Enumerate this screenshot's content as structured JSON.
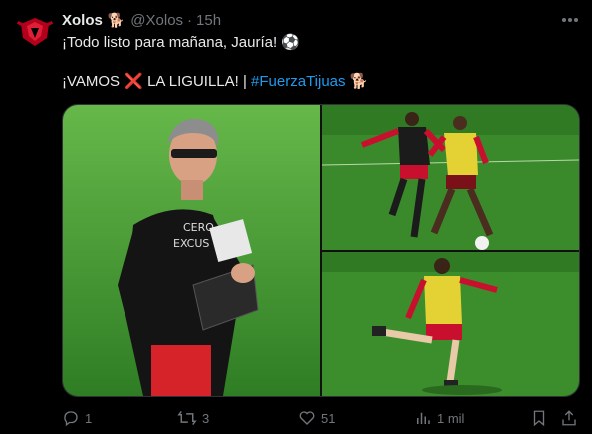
{
  "tweet": {
    "author_name": "Xolos",
    "author_badge": "🐕",
    "handle": "@Xolos",
    "separator": "·",
    "time": "15h",
    "line1_text": "¡Todo listo para mañana, Jauría! ",
    "line1_emoji": "⚽",
    "line2_text": "¡VAMOS ",
    "line2_cross": "❌",
    "line2_mid": " LA LIGUILLA! | ",
    "hashtag": "#FuerzaTijuas",
    "line2_emoji": " 🐕",
    "shirt_text_1": "CERO",
    "shirt_text_2": "EXCUS"
  },
  "actions": {
    "reply_count": "1",
    "retweet_count": "3",
    "like_count": "51",
    "views_count": "1 mil"
  },
  "colors": {
    "background": "#000000",
    "text": "#e7e9ea",
    "muted": "#71767b",
    "link": "#1d9bf0",
    "brand_red": "#c8102e",
    "pitch_green": "#3f8f2a"
  },
  "icons": {
    "more": "more-horizontal-icon",
    "reply": "reply-icon",
    "retweet": "retweet-icon",
    "like": "heart-icon",
    "views": "views-icon",
    "bookmark": "bookmark-icon",
    "share": "share-icon"
  }
}
